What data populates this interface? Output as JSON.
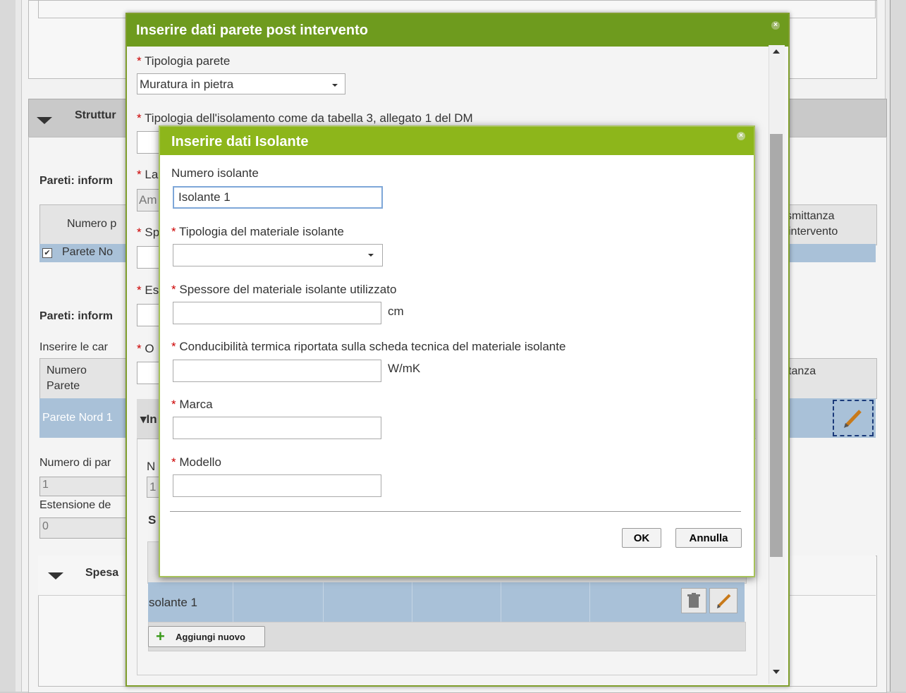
{
  "background": {
    "section_strutture": "Struttur",
    "pareti_info_1": "Pareti: inform",
    "col_numero_p": "Numero p",
    "row_parete_no": "Parete No",
    "col_smittanza": "smittanza",
    "col_intervento": "intervento",
    "pareti_info_2": "Pareti: inform",
    "inserire_car": "Inserire le car",
    "col_numero": "Numero",
    "col_parete": "Parete",
    "col_tanza": "tanza",
    "row_parete_nord": "Parete Nord 1",
    "numero_di_par": "Numero di par",
    "numero_val": "1",
    "estensione": "Estensione de",
    "estensione_val": "0",
    "spesa": "Spesa"
  },
  "dialog_parete": {
    "title": "Inserire dati parete post intervento",
    "close": "×",
    "tipologia_parete_label": "Tipologia parete",
    "tipologia_parete_value": "Muratura in pietra",
    "tipologia_isolamento_label": "Tipologia dell'isolamento come da tabella 3, allegato 1 del DM",
    "partial_la": "La",
    "partial_am": "Am",
    "partial_sp": "Sp",
    "partial_es": "Es",
    "partial_o": "O",
    "partial_in": "In",
    "partial_n": "N",
    "partial_1": "1",
    "partial_s": "S",
    "table_row_isolante": "solante 1",
    "add_new": "Aggiungi nuovo"
  },
  "dialog_isolante": {
    "title": "Inserire dati Isolante",
    "close": "×",
    "numero_label": "Numero isolante",
    "numero_value": "Isolante 1",
    "tipologia_label": "Tipologia del materiale isolante",
    "tipologia_value": "",
    "spessore_label": "Spessore del materiale isolante utilizzato",
    "spessore_unit": "cm",
    "spessore_value": "",
    "conducibilita_label": "Conducibilità termica riportata sulla scheda tecnica del materiale isolante",
    "conducibilita_unit": "W/mK",
    "conducibilita_value": "",
    "marca_label": "Marca",
    "marca_value": "",
    "modello_label": "Modello",
    "modello_value": "",
    "ok": "OK",
    "annulla": "Annulla"
  },
  "colors": {
    "dialog_title_dark": "#6e9b1e",
    "dialog_title_light": "#8db61b",
    "selected_row": "#a9c1d8",
    "required": "#cc0000"
  }
}
